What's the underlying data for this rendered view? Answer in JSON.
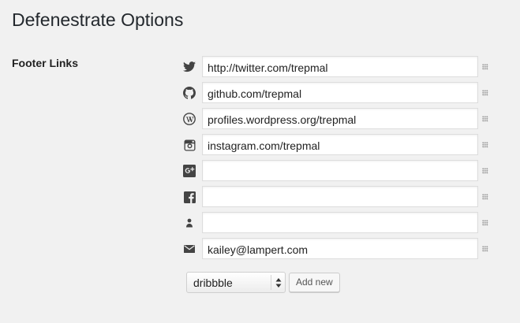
{
  "page": {
    "title": "Defenestrate Options"
  },
  "footer_links": {
    "label": "Footer Links",
    "items": [
      {
        "service": "twitter",
        "icon": "twitter-icon",
        "value": "http://twitter.com/trepmal"
      },
      {
        "service": "github",
        "icon": "github-icon",
        "value": "github.com/trepmal"
      },
      {
        "service": "wordpress",
        "icon": "wordpress-icon",
        "value": "profiles.wordpress.org/trepmal"
      },
      {
        "service": "instagram",
        "icon": "instagram-icon",
        "value": "instagram.com/trepmal"
      },
      {
        "service": "google-plus",
        "icon": "google-plus-icon",
        "value": ""
      },
      {
        "service": "facebook",
        "icon": "facebook-icon",
        "value": ""
      },
      {
        "service": "person",
        "icon": "person-icon",
        "value": ""
      },
      {
        "service": "email",
        "icon": "mail-icon",
        "value": "kailey@lampert.com"
      }
    ]
  },
  "add_controls": {
    "selected_service": "dribbble",
    "add_button_label": "Add new"
  },
  "colors": {
    "background": "#f1f1f1",
    "icon": "#444444",
    "input_border": "#dddddd"
  }
}
